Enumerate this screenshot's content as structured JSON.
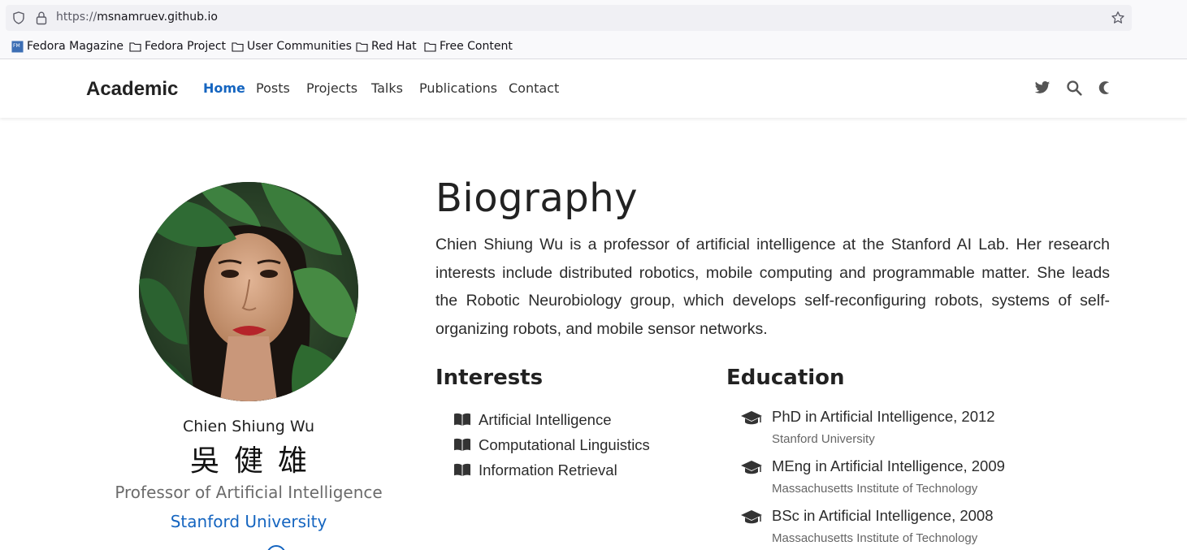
{
  "browser": {
    "url_prefix": "https://",
    "url_host": "msnamruev.github.io",
    "bookmarks": [
      {
        "label": "Fedora Magazine",
        "icon": "fedora-magazine-icon"
      },
      {
        "label": "Fedora Project",
        "icon": "folder-icon"
      },
      {
        "label": "User Communities",
        "icon": "folder-icon"
      },
      {
        "label": "Red Hat",
        "icon": "folder-icon"
      },
      {
        "label": "Free Content",
        "icon": "folder-icon"
      }
    ]
  },
  "navbar": {
    "brand": "Academic",
    "items": [
      "Home",
      "Posts",
      "Projects",
      "Talks",
      "Publications",
      "Contact"
    ],
    "active": "Home",
    "icons": [
      "twitter-icon",
      "search-icon",
      "moon-icon"
    ],
    "accent": "#1565c0"
  },
  "profile": {
    "name": "Chien Shiung Wu",
    "name_zh": "吳健雄",
    "role": "Professor of Artificial Intelligence",
    "organization": "Stanford University"
  },
  "biography": {
    "title": "Biography",
    "text": "Chien Shiung Wu is a professor of artificial intelligence at the Stanford AI Lab. Her research interests include distributed robotics, mobile computing and programmable matter. She leads the Robotic Neurobiology group, which develops self-reconfiguring robots, systems of self-organizing robots, and mobile sensor networks."
  },
  "interests": {
    "title": "Interests",
    "items": [
      "Artificial Intelligence",
      "Computational Linguistics",
      "Information Retrieval"
    ]
  },
  "education": {
    "title": "Education",
    "items": [
      {
        "course": "PhD in Artificial Intelligence, 2012",
        "institution": "Stanford University"
      },
      {
        "course": "MEng in Artificial Intelligence, 2009",
        "institution": "Massachusetts Institute of Technology"
      },
      {
        "course": "BSc in Artificial Intelligence, 2008",
        "institution": "Massachusetts Institute of Technology"
      }
    ]
  }
}
